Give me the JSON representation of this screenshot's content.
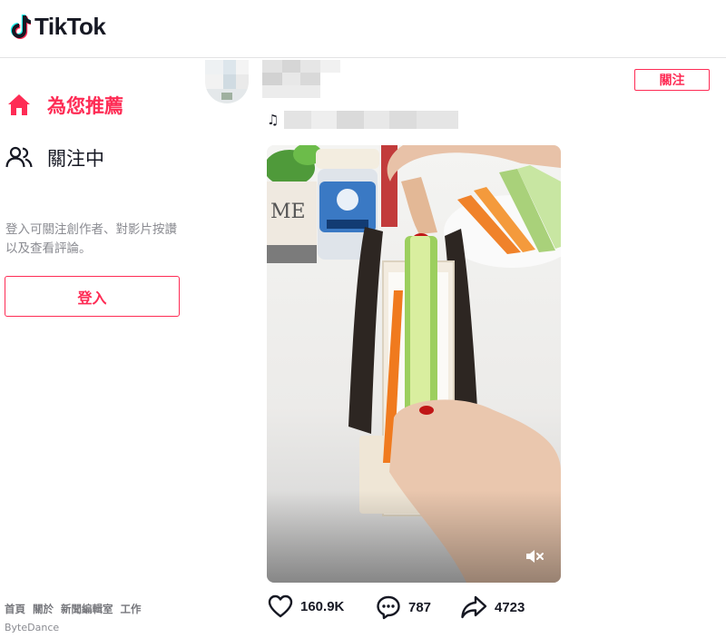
{
  "header": {
    "logo_text": "TikTok"
  },
  "sidebar": {
    "items": [
      {
        "label": "為您推薦",
        "icon": "home-icon",
        "active": true
      },
      {
        "label": "關注中",
        "icon": "users-icon",
        "active": false
      }
    ],
    "login_tip": "登入可關注創作者、對影片按讚以及查看評論。",
    "login_button": "登入",
    "footer_links": [
      "首頁",
      "關於",
      "新聞編輯室",
      "工作"
    ],
    "copyright": "ByteDance"
  },
  "post": {
    "follow_button": "關注",
    "music_icon": "music-note-icon",
    "stats": {
      "likes": "160.9K",
      "comments": "787",
      "shares": "4723"
    }
  },
  "colors": {
    "accent": "#fe2c55",
    "text": "#161823",
    "muted": "#8a8b91"
  }
}
